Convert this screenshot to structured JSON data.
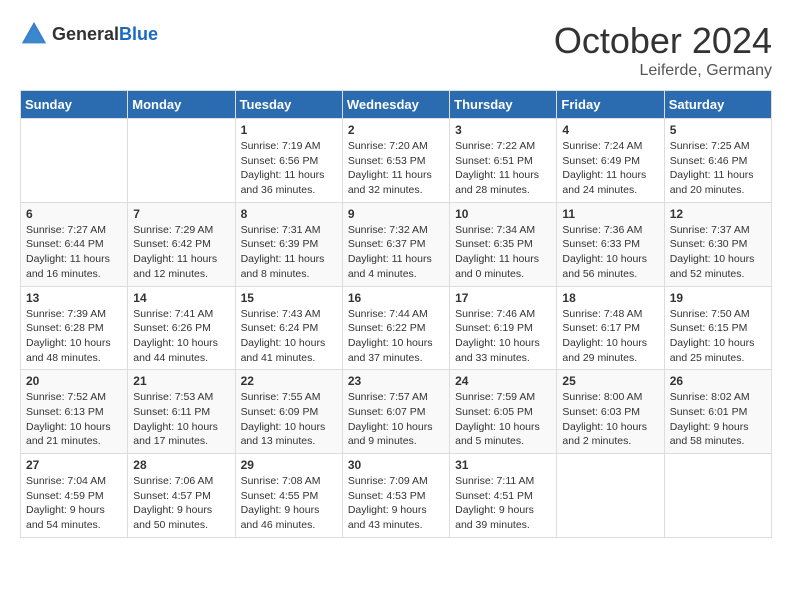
{
  "logo": {
    "text_general": "General",
    "text_blue": "Blue"
  },
  "header": {
    "month": "October 2024",
    "location": "Leiferde, Germany"
  },
  "days_of_week": [
    "Sunday",
    "Monday",
    "Tuesday",
    "Wednesday",
    "Thursday",
    "Friday",
    "Saturday"
  ],
  "weeks": [
    [
      {
        "day": "",
        "info": ""
      },
      {
        "day": "",
        "info": ""
      },
      {
        "day": "1",
        "info": "Sunrise: 7:19 AM\nSunset: 6:56 PM\nDaylight: 11 hours\nand 36 minutes."
      },
      {
        "day": "2",
        "info": "Sunrise: 7:20 AM\nSunset: 6:53 PM\nDaylight: 11 hours\nand 32 minutes."
      },
      {
        "day": "3",
        "info": "Sunrise: 7:22 AM\nSunset: 6:51 PM\nDaylight: 11 hours\nand 28 minutes."
      },
      {
        "day": "4",
        "info": "Sunrise: 7:24 AM\nSunset: 6:49 PM\nDaylight: 11 hours\nand 24 minutes."
      },
      {
        "day": "5",
        "info": "Sunrise: 7:25 AM\nSunset: 6:46 PM\nDaylight: 11 hours\nand 20 minutes."
      }
    ],
    [
      {
        "day": "6",
        "info": "Sunrise: 7:27 AM\nSunset: 6:44 PM\nDaylight: 11 hours\nand 16 minutes."
      },
      {
        "day": "7",
        "info": "Sunrise: 7:29 AM\nSunset: 6:42 PM\nDaylight: 11 hours\nand 12 minutes."
      },
      {
        "day": "8",
        "info": "Sunrise: 7:31 AM\nSunset: 6:39 PM\nDaylight: 11 hours\nand 8 minutes."
      },
      {
        "day": "9",
        "info": "Sunrise: 7:32 AM\nSunset: 6:37 PM\nDaylight: 11 hours\nand 4 minutes."
      },
      {
        "day": "10",
        "info": "Sunrise: 7:34 AM\nSunset: 6:35 PM\nDaylight: 11 hours\nand 0 minutes."
      },
      {
        "day": "11",
        "info": "Sunrise: 7:36 AM\nSunset: 6:33 PM\nDaylight: 10 hours\nand 56 minutes."
      },
      {
        "day": "12",
        "info": "Sunrise: 7:37 AM\nSunset: 6:30 PM\nDaylight: 10 hours\nand 52 minutes."
      }
    ],
    [
      {
        "day": "13",
        "info": "Sunrise: 7:39 AM\nSunset: 6:28 PM\nDaylight: 10 hours\nand 48 minutes."
      },
      {
        "day": "14",
        "info": "Sunrise: 7:41 AM\nSunset: 6:26 PM\nDaylight: 10 hours\nand 44 minutes."
      },
      {
        "day": "15",
        "info": "Sunrise: 7:43 AM\nSunset: 6:24 PM\nDaylight: 10 hours\nand 41 minutes."
      },
      {
        "day": "16",
        "info": "Sunrise: 7:44 AM\nSunset: 6:22 PM\nDaylight: 10 hours\nand 37 minutes."
      },
      {
        "day": "17",
        "info": "Sunrise: 7:46 AM\nSunset: 6:19 PM\nDaylight: 10 hours\nand 33 minutes."
      },
      {
        "day": "18",
        "info": "Sunrise: 7:48 AM\nSunset: 6:17 PM\nDaylight: 10 hours\nand 29 minutes."
      },
      {
        "day": "19",
        "info": "Sunrise: 7:50 AM\nSunset: 6:15 PM\nDaylight: 10 hours\nand 25 minutes."
      }
    ],
    [
      {
        "day": "20",
        "info": "Sunrise: 7:52 AM\nSunset: 6:13 PM\nDaylight: 10 hours\nand 21 minutes."
      },
      {
        "day": "21",
        "info": "Sunrise: 7:53 AM\nSunset: 6:11 PM\nDaylight: 10 hours\nand 17 minutes."
      },
      {
        "day": "22",
        "info": "Sunrise: 7:55 AM\nSunset: 6:09 PM\nDaylight: 10 hours\nand 13 minutes."
      },
      {
        "day": "23",
        "info": "Sunrise: 7:57 AM\nSunset: 6:07 PM\nDaylight: 10 hours\nand 9 minutes."
      },
      {
        "day": "24",
        "info": "Sunrise: 7:59 AM\nSunset: 6:05 PM\nDaylight: 10 hours\nand 5 minutes."
      },
      {
        "day": "25",
        "info": "Sunrise: 8:00 AM\nSunset: 6:03 PM\nDaylight: 10 hours\nand 2 minutes."
      },
      {
        "day": "26",
        "info": "Sunrise: 8:02 AM\nSunset: 6:01 PM\nDaylight: 9 hours\nand 58 minutes."
      }
    ],
    [
      {
        "day": "27",
        "info": "Sunrise: 7:04 AM\nSunset: 4:59 PM\nDaylight: 9 hours\nand 54 minutes."
      },
      {
        "day": "28",
        "info": "Sunrise: 7:06 AM\nSunset: 4:57 PM\nDaylight: 9 hours\nand 50 minutes."
      },
      {
        "day": "29",
        "info": "Sunrise: 7:08 AM\nSunset: 4:55 PM\nDaylight: 9 hours\nand 46 minutes."
      },
      {
        "day": "30",
        "info": "Sunrise: 7:09 AM\nSunset: 4:53 PM\nDaylight: 9 hours\nand 43 minutes."
      },
      {
        "day": "31",
        "info": "Sunrise: 7:11 AM\nSunset: 4:51 PM\nDaylight: 9 hours\nand 39 minutes."
      },
      {
        "day": "",
        "info": ""
      },
      {
        "day": "",
        "info": ""
      }
    ]
  ]
}
